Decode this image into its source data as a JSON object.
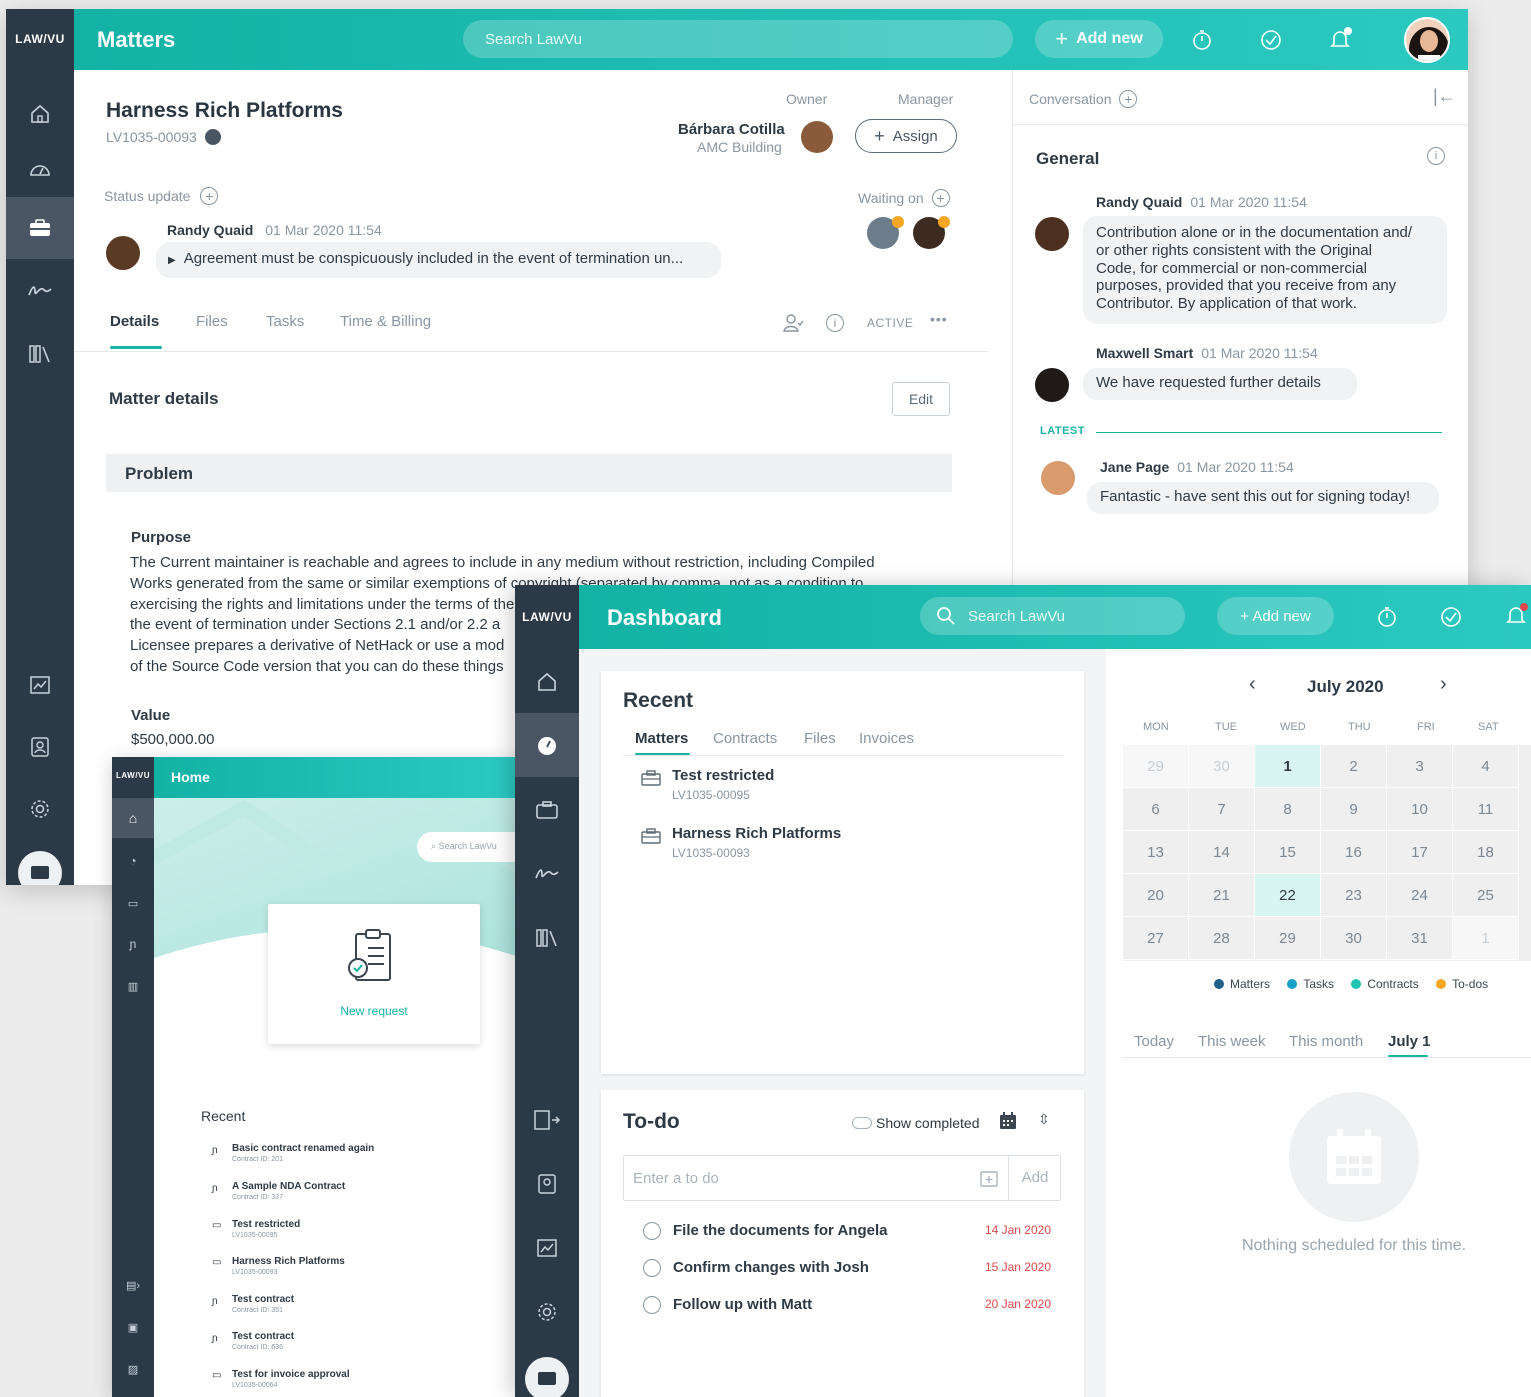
{
  "matters_window": {
    "logo": "LAW/VU",
    "title": "Matters",
    "search_placeholder": "Search LawVu",
    "add_new": "Add new",
    "matter_name": "Harness Rich Platforms",
    "matter_id": "LV1035-00093",
    "owner_label": "Owner",
    "manager_label": "Manager",
    "owner_name": "Bárbara Cotilla",
    "owner_location": "AMC Building",
    "assign_label": "Assign",
    "status_update_label": "Status update",
    "waiting_on_label": "Waiting on",
    "status_author": "Randy Quaid",
    "status_time": "01 Mar 2020 11:54",
    "status_text": "Agreement must be conspicuously included in the event of termination un...",
    "tabs": [
      "Details",
      "Files",
      "Tasks",
      "Time & Billing"
    ],
    "status_badge": "ACTIVE",
    "section_title": "Matter details",
    "edit_label": "Edit",
    "problem_label": "Problem",
    "purpose_label": "Purpose",
    "purpose_lines": [
      "The Current maintainer is reachable and agrees to include in any medium without restriction, including Compiled",
      "Works generated from the same or similar exemptions of copyright (separated by comma, not as a condition to",
      "exercising the rights and limitations under the terms of the",
      "the event of termination under Sections 2.1 and/or 2.2 a",
      "Licensee prepares a derivative of NetHack or use a mod",
      "of the Source Code version that you can do these things"
    ],
    "value_label": "Value",
    "value": "$500,000.00",
    "conversation": {
      "label": "Conversation",
      "channel": "General",
      "latest_label": "LATEST",
      "messages": [
        {
          "author": "Randy Quaid",
          "time": "01 Mar 2020 11:54",
          "lines": [
            "Contribution alone or in the documentation and/",
            "or other rights consistent with the Original",
            "Code, for commercial or non-commercial",
            "purposes, provided that you receive from any",
            "Contributor. By application of that work."
          ]
        },
        {
          "author": "Maxwell Smart",
          "time": "01 Mar 2020 11:54",
          "lines": [
            "We have requested further details"
          ]
        },
        {
          "author": "Jane Page",
          "time": "01 Mar 2020 11:54",
          "lines": [
            "Fantastic - have sent this out for signing today!"
          ]
        }
      ]
    }
  },
  "home_window": {
    "logo": "LAW/VU",
    "title": "Home",
    "search_placeholder": "Search LawVu",
    "new_request": "New request",
    "recent_label": "Recent",
    "recent_items": [
      {
        "name": "Basic contract renamed again",
        "sub": "Contract ID: 201",
        "icon": "signature-icon"
      },
      {
        "name": "A Sample NDA Contract",
        "sub": "Contract ID: 337",
        "icon": "signature-icon"
      },
      {
        "name": "Test restricted",
        "sub": "LV1035-00095",
        "icon": "briefcase-icon"
      },
      {
        "name": "Harness Rich Platforms",
        "sub": "LV1035-00093",
        "icon": "briefcase-icon"
      },
      {
        "name": "Test contract",
        "sub": "Contract ID: 351",
        "icon": "signature-icon"
      },
      {
        "name": "Test contract",
        "sub": "Contract ID: 636",
        "icon": "signature-icon"
      },
      {
        "name": "Test for invoice approval",
        "sub": "LV1035-00064",
        "icon": "briefcase-icon"
      }
    ]
  },
  "dashboard_window": {
    "logo": "LAW/VU",
    "title": "Dashboard",
    "search_placeholder": "Search LawVu",
    "add_new": "+ Add new",
    "recent_label": "Recent",
    "recent_tabs": [
      "Matters",
      "Contracts",
      "Files",
      "Invoices"
    ],
    "recent_items": [
      {
        "name": "Test restricted",
        "sub": "LV1035-00095"
      },
      {
        "name": "Harness Rich Platforms",
        "sub": "LV1035-00093"
      }
    ],
    "todo_label": "To-do",
    "show_completed": "Show completed",
    "todo_placeholder": "Enter a to do",
    "todo_add": "Add",
    "todos": [
      {
        "text": "File the documents for Angela",
        "date": "14 Jan 2020"
      },
      {
        "text": "Confirm changes with Josh",
        "date": "15 Jan 2020"
      },
      {
        "text": "Follow up with Matt",
        "date": "20 Jan 2020"
      }
    ],
    "calendar": {
      "month": "July 2020",
      "weekdays": [
        "MON",
        "TUE",
        "WED",
        "THU",
        "FRI",
        "SAT"
      ],
      "weeks": [
        [
          "29",
          "30",
          "1",
          "2",
          "3",
          "4"
        ],
        [
          "6",
          "7",
          "8",
          "9",
          "10",
          "11"
        ],
        [
          "13",
          "14",
          "15",
          "16",
          "17",
          "18"
        ],
        [
          "20",
          "21",
          "22",
          "23",
          "24",
          "25"
        ],
        [
          "27",
          "28",
          "29",
          "30",
          "31",
          "1"
        ]
      ],
      "legend": [
        {
          "label": "Matters",
          "color": "#1f5f88"
        },
        {
          "label": "Tasks",
          "color": "#1aa0c8"
        },
        {
          "label": "Contracts",
          "color": "#22c4b4"
        },
        {
          "label": "To-dos",
          "color": "#f5a623"
        }
      ],
      "range_tabs": [
        "Today",
        "This week",
        "This month",
        "July 1"
      ],
      "empty_text": "Nothing scheduled for this time."
    }
  },
  "colors": {
    "accent": "#17b3a6",
    "sidebar": "#2c3a47",
    "danger": "#e04a4a"
  }
}
